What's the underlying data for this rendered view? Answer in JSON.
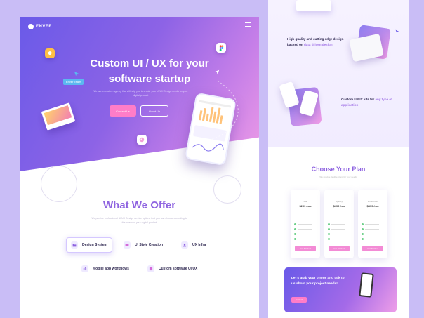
{
  "brand": {
    "logo_text": "ENVEE"
  },
  "hero": {
    "title_line1": "Custom UI / UX for your",
    "title_line2": "software startup",
    "subtitle": "We are a creative agency that will help you to create your UI/UX Design needs for your digital product",
    "tag": "Enver Team",
    "primary_button": "Contact Us",
    "secondary_button": "About Us"
  },
  "offer": {
    "title": "What We Offer",
    "subtitle": "We provide professional UI/UX Design service options that you can choose according to the needs of your digital product",
    "items": [
      {
        "label": "Design System",
        "icon": "folder-icon"
      },
      {
        "label": "UI Style Creation",
        "icon": "image-icon"
      },
      {
        "label": "UX Infra",
        "icon": "user-icon"
      },
      {
        "label": "Mobile app workflows",
        "icon": "arrow-icon"
      },
      {
        "label": "Custom software UI/UX",
        "icon": "layers-icon"
      }
    ]
  },
  "right": {
    "feature1_pre": "High quality and cutting edge design backed on ",
    "feature1_hl": "data driven design",
    "feature2_pre": "Custom UI/UX kits for ",
    "feature2_hl": "any type of application",
    "plans_title": "Choose Your Plan",
    "plans_subtitle": "We provide flexible plans for your needs",
    "plans": [
      {
        "name": "Lite",
        "price": "$299 /mo",
        "button": "Get Started"
      },
      {
        "name": "Agency",
        "price": "$499 /mo",
        "button": "Get Started"
      },
      {
        "name": "Enterprise",
        "price": "$899 /mo",
        "button": "Get Started"
      }
    ],
    "cta_text": "Let's grab your phone and talk to us about your project needs!",
    "cta_button": "Contact"
  },
  "colors": {
    "primary": "#8e63e0",
    "accent": "#ff7dc8",
    "bg": "#c9bdf6"
  }
}
